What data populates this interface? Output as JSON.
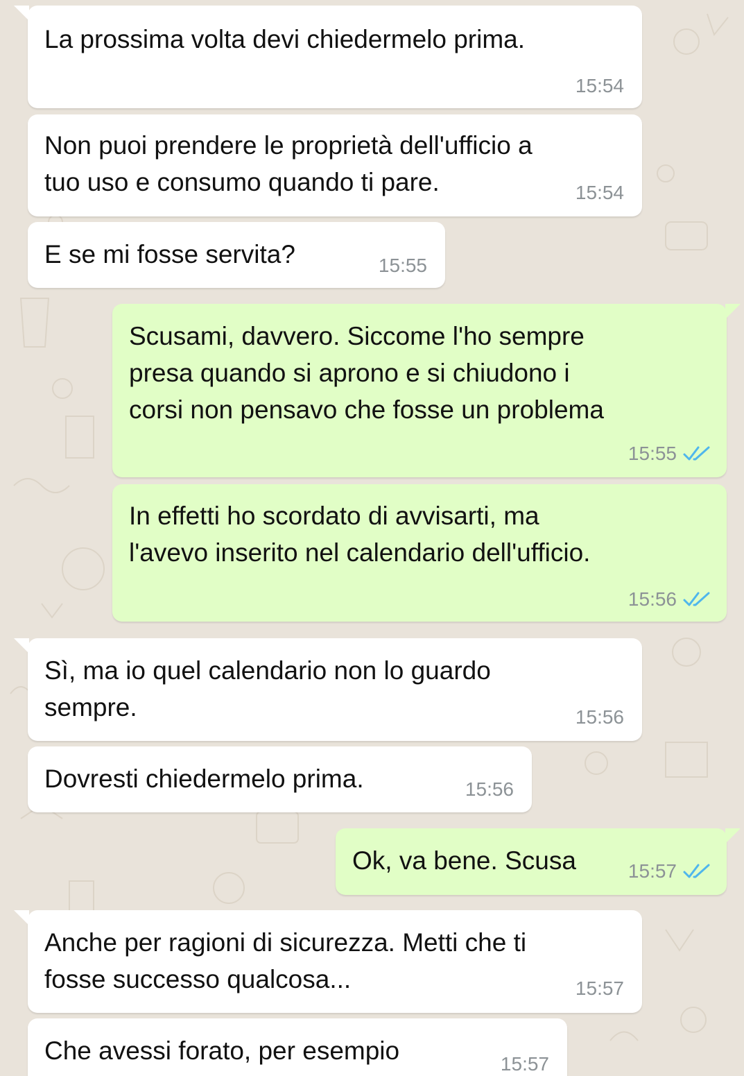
{
  "colors": {
    "background": "#e9e3da",
    "incoming_bubble": "#ffffff",
    "outgoing_bubble": "#e1fec6",
    "timestamp": "#8c9296",
    "read_ticks": "#4fb6ec"
  },
  "messages": [
    {
      "direction": "incoming",
      "lines": [
        "La prossima volta devi chiedermelo prima."
      ],
      "time": "15:54"
    },
    {
      "direction": "incoming",
      "lines": [
        "Non puoi prendere le proprietà dell'ufficio a",
        "tuo uso e consumo quando ti pare."
      ],
      "time": "15:54"
    },
    {
      "direction": "incoming",
      "lines": [
        "E se mi fosse servita?"
      ],
      "time": "15:55"
    },
    {
      "direction": "outgoing",
      "lines": [
        "Scusami, davvero. Siccome l'ho sempre",
        "presa quando si aprono e si chiudono i",
        "corsi non pensavo che fosse un problema"
      ],
      "time": "15:55",
      "status_icon": "double-check-read-icon"
    },
    {
      "direction": "outgoing",
      "lines": [
        "In effetti ho scordato di avvisarti, ma",
        "l'avevo inserito nel calendario dell'ufficio."
      ],
      "time": "15:56",
      "status_icon": "double-check-read-icon"
    },
    {
      "direction": "incoming",
      "lines": [
        "Sì, ma io quel calendario non lo guardo",
        "sempre."
      ],
      "time": "15:56"
    },
    {
      "direction": "incoming",
      "lines": [
        "Dovresti chiedermelo prima."
      ],
      "time": "15:56"
    },
    {
      "direction": "outgoing",
      "lines": [
        "Ok, va bene. Scusa"
      ],
      "time": "15:57",
      "status_icon": "double-check-read-icon"
    },
    {
      "direction": "incoming",
      "lines": [
        "Anche per ragioni di sicurezza. Metti che ti",
        "fosse successo qualcosa..."
      ],
      "time": "15:57"
    },
    {
      "direction": "incoming",
      "lines": [
        "Che avessi forato, per esempio"
      ],
      "time": "15:57"
    }
  ]
}
